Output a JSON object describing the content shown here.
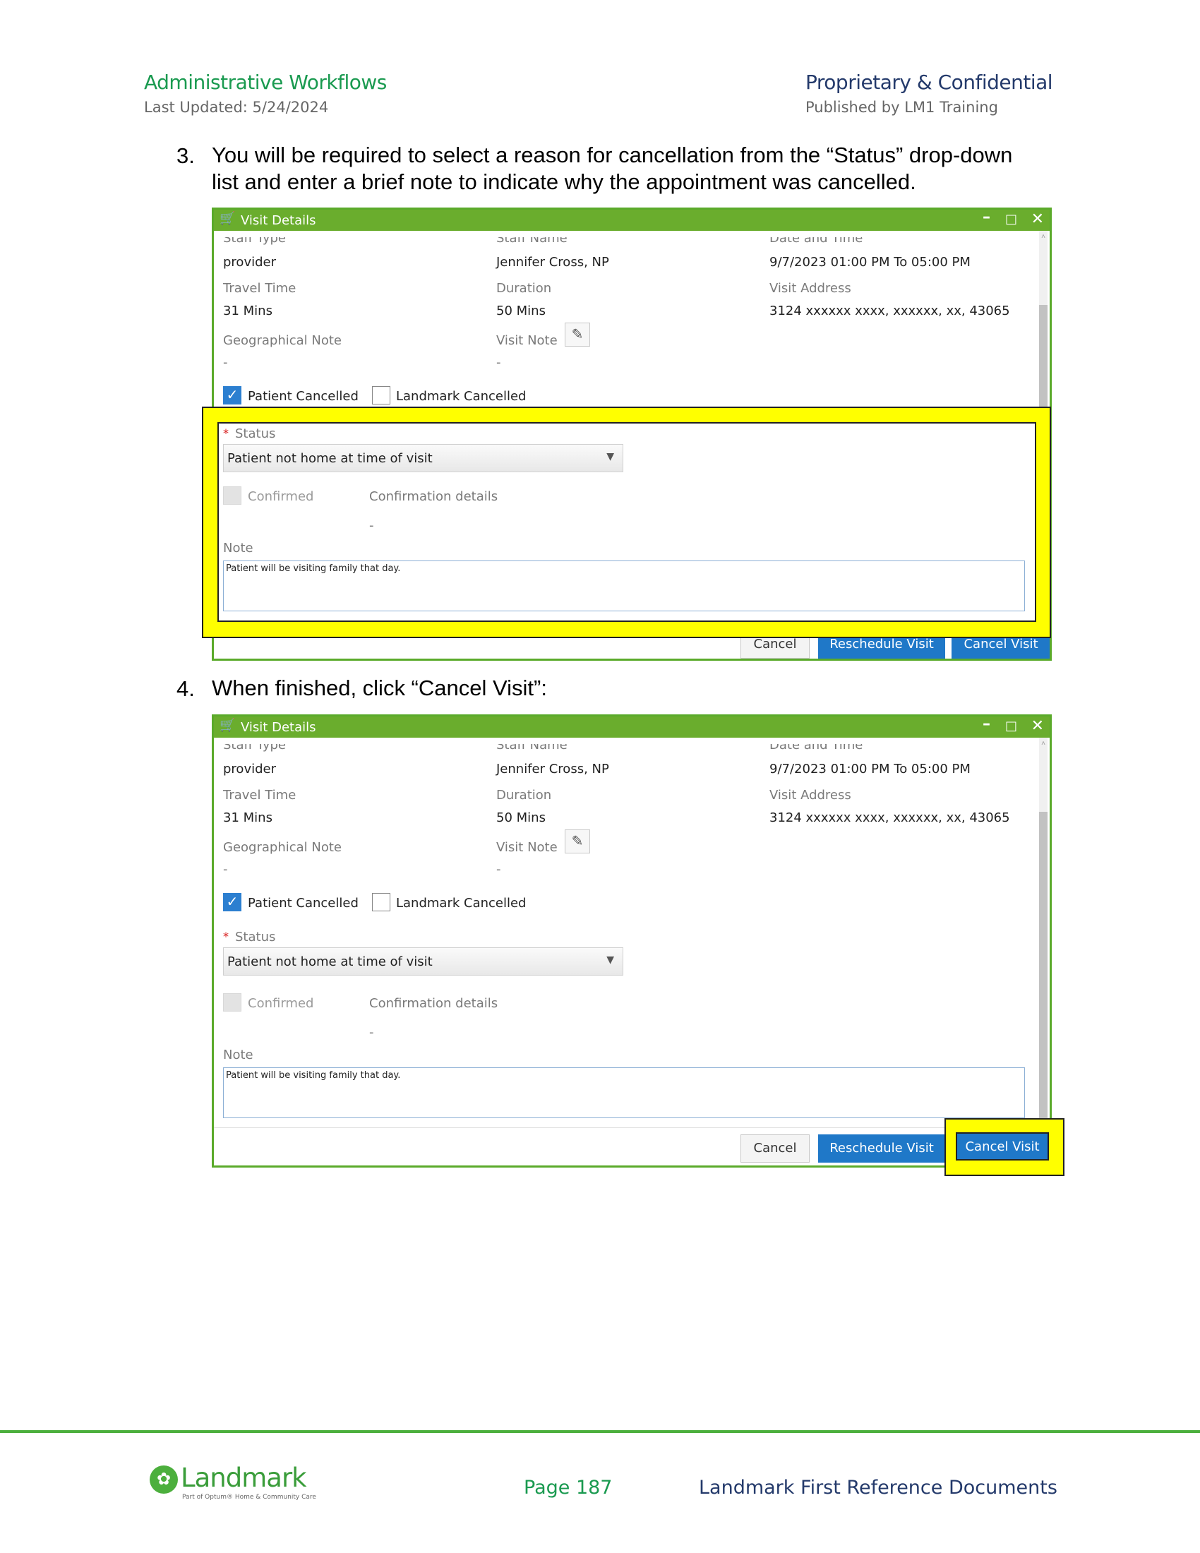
{
  "header": {
    "left_title": "Administrative Workflows",
    "left_sub": "Last Updated: 5/24/2024",
    "right_title": "Proprietary & Confidential",
    "right_sub": "Published by LM1 Training"
  },
  "steps": [
    {
      "num": "3.",
      "text": "You will be required to select a reason for cancellation from the “Status” drop-down list and enter a brief note to indicate why the appointment was cancelled."
    },
    {
      "num": "4.",
      "text": "When finished, click “Cancel Visit”:"
    }
  ],
  "dialog": {
    "title": "Visit Details",
    "window_controls": {
      "minimize": "–",
      "maximize": "□",
      "close": "✕"
    },
    "title_icon": "cart-icon",
    "staff_type_label": "Staff Type",
    "staff_type": "provider",
    "staff_name_label": "Staff Name",
    "staff_name": "Jennifer Cross, NP",
    "date_time_label": "Date and Time",
    "date_time": "9/7/2023 01:00 PM To 05:00 PM",
    "travel_time_label": "Travel Time",
    "travel_time": "31 Mins",
    "duration_label": "Duration",
    "duration": "50 Mins",
    "visit_address_label": "Visit Address",
    "visit_address": "3124 xxxxxx xxxx, xxxxxx, xx, 43065",
    "geo_note_label": "Geographical Note",
    "geo_note": "-",
    "visit_note_label": "Visit Note",
    "visit_note": "-",
    "patient_cancelled_label": "Patient Cancelled",
    "patient_cancelled": true,
    "landmark_cancelled_label": "Landmark Cancelled",
    "landmark_cancelled": false,
    "required_mark": "*",
    "status_label": "Status",
    "status_value": "Patient not home at time of visit",
    "confirmed_label": "Confirmed",
    "confirmation_details_label": "Confirmation details",
    "confirmation_details": "-",
    "note_label": "Note",
    "note_value": "Patient will be visiting family that day.",
    "cancel_label": "Cancel",
    "reschedule_label": "Reschedule Visit",
    "cancel_visit_label": "Cancel Visit"
  },
  "footer": {
    "logo_word": "Landmark",
    "logo_tagline": "Part of Optum® Home & Community Care",
    "page": "Page 187",
    "doc_ref": "Landmark First Reference Documents"
  },
  "colors": {
    "brand_green": "#4caf3d",
    "title_green": "#1a9a50",
    "navy": "#243a6b",
    "dialog_titlebar": "#6aad2d",
    "primary_button": "#1f78c8",
    "highlight": "#ffff00"
  }
}
